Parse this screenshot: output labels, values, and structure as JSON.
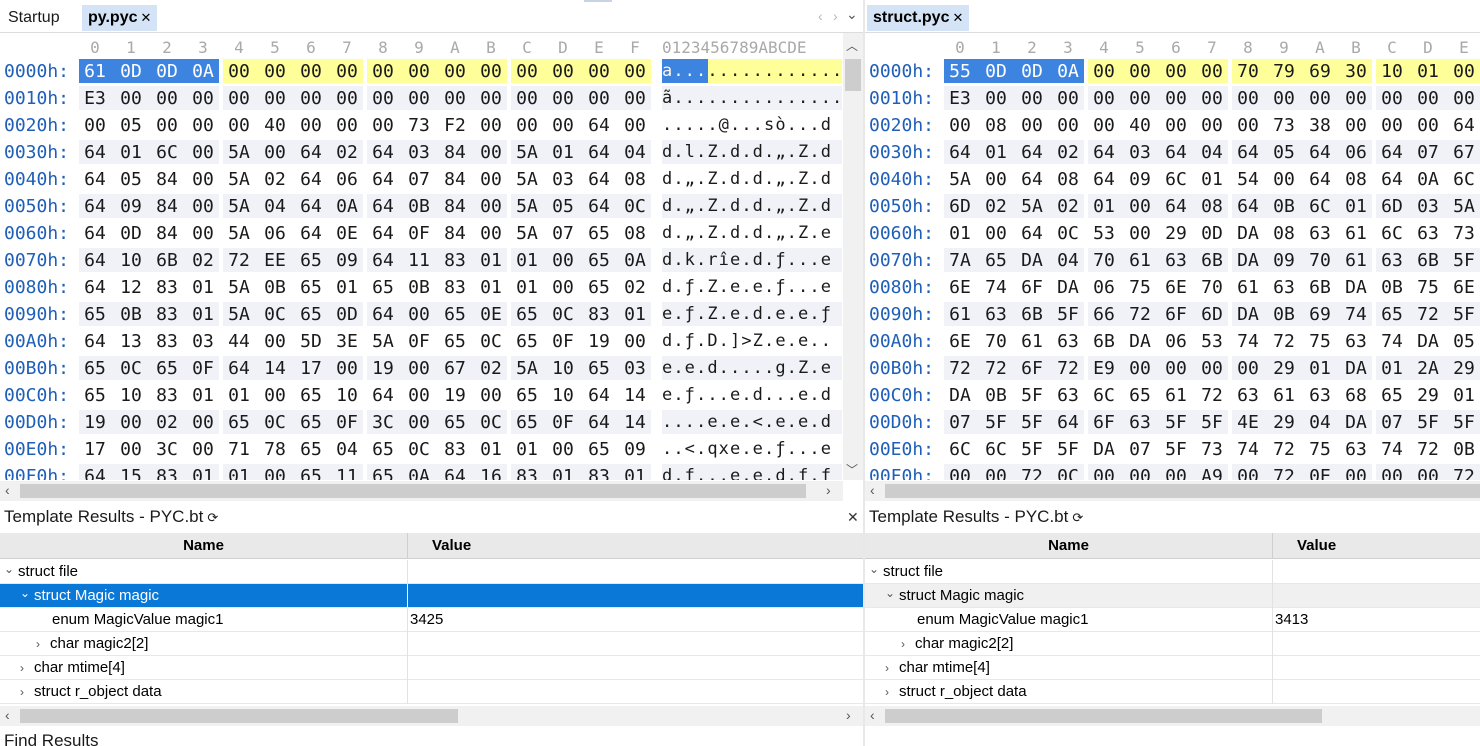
{
  "left": {
    "tabs": [
      {
        "label": "Startup",
        "active": false,
        "closable": false
      },
      {
        "label": "py.pyc",
        "active": true,
        "closable": true
      }
    ],
    "column_header": [
      "0",
      "1",
      "2",
      "3",
      "4",
      "5",
      "6",
      "7",
      "8",
      "9",
      "A",
      "B",
      "C",
      "D",
      "E",
      "F"
    ],
    "ascii_header": "0123456789ABCDE",
    "rows": [
      {
        "addr": "0000h:",
        "bytes": [
          "61",
          "0D",
          "0D",
          "0A",
          "00",
          "00",
          "00",
          "00",
          "00",
          "00",
          "00",
          "00",
          "00",
          "00",
          "00",
          "00"
        ],
        "ascii": "a..............."
      },
      {
        "addr": "0010h:",
        "bytes": [
          "E3",
          "00",
          "00",
          "00",
          "00",
          "00",
          "00",
          "00",
          "00",
          "00",
          "00",
          "00",
          "00",
          "00",
          "00",
          "00"
        ],
        "ascii": "ã..............."
      },
      {
        "addr": "0020h:",
        "bytes": [
          "00",
          "05",
          "00",
          "00",
          "00",
          "40",
          "00",
          "00",
          "00",
          "73",
          "F2",
          "00",
          "00",
          "00",
          "64",
          "00"
        ],
        "ascii": ".....@...sò...d"
      },
      {
        "addr": "0030h:",
        "bytes": [
          "64",
          "01",
          "6C",
          "00",
          "5A",
          "00",
          "64",
          "02",
          "64",
          "03",
          "84",
          "00",
          "5A",
          "01",
          "64",
          "04"
        ],
        "ascii": "d.l.Z.d.d.„.Z.d"
      },
      {
        "addr": "0040h:",
        "bytes": [
          "64",
          "05",
          "84",
          "00",
          "5A",
          "02",
          "64",
          "06",
          "64",
          "07",
          "84",
          "00",
          "5A",
          "03",
          "64",
          "08"
        ],
        "ascii": "d.„.Z.d.d.„.Z.d"
      },
      {
        "addr": "0050h:",
        "bytes": [
          "64",
          "09",
          "84",
          "00",
          "5A",
          "04",
          "64",
          "0A",
          "64",
          "0B",
          "84",
          "00",
          "5A",
          "05",
          "64",
          "0C"
        ],
        "ascii": "d.„.Z.d.d.„.Z.d"
      },
      {
        "addr": "0060h:",
        "bytes": [
          "64",
          "0D",
          "84",
          "00",
          "5A",
          "06",
          "64",
          "0E",
          "64",
          "0F",
          "84",
          "00",
          "5A",
          "07",
          "65",
          "08"
        ],
        "ascii": "d.„.Z.d.d.„.Z.e"
      },
      {
        "addr": "0070h:",
        "bytes": [
          "64",
          "10",
          "6B",
          "02",
          "72",
          "EE",
          "65",
          "09",
          "64",
          "11",
          "83",
          "01",
          "01",
          "00",
          "65",
          "0A"
        ],
        "ascii": "d.k.rîe.d.ƒ...e"
      },
      {
        "addr": "0080h:",
        "bytes": [
          "64",
          "12",
          "83",
          "01",
          "5A",
          "0B",
          "65",
          "01",
          "65",
          "0B",
          "83",
          "01",
          "01",
          "00",
          "65",
          "02"
        ],
        "ascii": "d.ƒ.Z.e.e.ƒ...e"
      },
      {
        "addr": "0090h:",
        "bytes": [
          "65",
          "0B",
          "83",
          "01",
          "5A",
          "0C",
          "65",
          "0D",
          "64",
          "00",
          "65",
          "0E",
          "65",
          "0C",
          "83",
          "01"
        ],
        "ascii": "e.ƒ.Z.e.d.e.e.ƒ"
      },
      {
        "addr": "00A0h:",
        "bytes": [
          "64",
          "13",
          "83",
          "03",
          "44",
          "00",
          "5D",
          "3E",
          "5A",
          "0F",
          "65",
          "0C",
          "65",
          "0F",
          "19",
          "00"
        ],
        "ascii": "d.ƒ.D.]>Z.e.e.."
      },
      {
        "addr": "00B0h:",
        "bytes": [
          "65",
          "0C",
          "65",
          "0F",
          "64",
          "14",
          "17",
          "00",
          "19",
          "00",
          "67",
          "02",
          "5A",
          "10",
          "65",
          "03"
        ],
        "ascii": "e.e.d.....g.Z.e"
      },
      {
        "addr": "00C0h:",
        "bytes": [
          "65",
          "10",
          "83",
          "01",
          "01",
          "00",
          "65",
          "10",
          "64",
          "00",
          "19",
          "00",
          "65",
          "10",
          "64",
          "14"
        ],
        "ascii": "e.ƒ...e.d...e.d"
      },
      {
        "addr": "00D0h:",
        "bytes": [
          "19",
          "00",
          "02",
          "00",
          "65",
          "0C",
          "65",
          "0F",
          "3C",
          "00",
          "65",
          "0C",
          "65",
          "0F",
          "64",
          "14"
        ],
        "ascii": "....e.e.<.e.e.d"
      },
      {
        "addr": "00E0h:",
        "bytes": [
          "17",
          "00",
          "3C",
          "00",
          "71",
          "78",
          "65",
          "04",
          "65",
          "0C",
          "83",
          "01",
          "01",
          "00",
          "65",
          "09"
        ],
        "ascii": "..<.qxe.e.ƒ...e"
      },
      {
        "addr": "00F0h:",
        "bytes": [
          "64",
          "15",
          "83",
          "01",
          "01",
          "00",
          "65",
          "11",
          "65",
          "0A",
          "64",
          "16",
          "83",
          "01",
          "83",
          "01"
        ],
        "ascii": "d.ƒ...e.e.d.ƒ.ƒ"
      }
    ],
    "template_title": "Template Results - PYC.bt",
    "grid": {
      "headers": [
        "Name",
        "Value"
      ],
      "rows": [
        {
          "name": "struct file",
          "value": "",
          "indent": 0,
          "chevron": "down"
        },
        {
          "name": "struct Magic magic",
          "value": "",
          "indent": 1,
          "chevron": "down",
          "selected": true
        },
        {
          "name": "enum MagicValue magic1",
          "value": "3425",
          "indent": 3,
          "chevron": ""
        },
        {
          "name": "char magic2[2]",
          "value": "",
          "indent": 2,
          "chevron": "right"
        },
        {
          "name": "char mtime[4]",
          "value": "",
          "indent": 1,
          "chevron": "right"
        },
        {
          "name": "struct r_object data",
          "value": "",
          "indent": 1,
          "chevron": "right"
        }
      ]
    }
  },
  "right": {
    "tabs": [
      {
        "label": "struct.pyc",
        "active": true,
        "closable": true
      }
    ],
    "column_header": [
      "0",
      "1",
      "2",
      "3",
      "4",
      "5",
      "6",
      "7",
      "8",
      "9",
      "A",
      "B",
      "C",
      "D",
      "E"
    ],
    "rows": [
      {
        "addr": "0000h:",
        "bytes": [
          "55",
          "0D",
          "0D",
          "0A",
          "00",
          "00",
          "00",
          "00",
          "70",
          "79",
          "69",
          "30",
          "10",
          "01",
          "00"
        ]
      },
      {
        "addr": "0010h:",
        "bytes": [
          "E3",
          "00",
          "00",
          "00",
          "00",
          "00",
          "00",
          "00",
          "00",
          "00",
          "00",
          "00",
          "00",
          "00",
          "00"
        ]
      },
      {
        "addr": "0020h:",
        "bytes": [
          "00",
          "08",
          "00",
          "00",
          "00",
          "40",
          "00",
          "00",
          "00",
          "73",
          "38",
          "00",
          "00",
          "00",
          "64"
        ]
      },
      {
        "addr": "0030h:",
        "bytes": [
          "64",
          "01",
          "64",
          "02",
          "64",
          "03",
          "64",
          "04",
          "64",
          "05",
          "64",
          "06",
          "64",
          "07",
          "67"
        ]
      },
      {
        "addr": "0040h:",
        "bytes": [
          "5A",
          "00",
          "64",
          "08",
          "64",
          "09",
          "6C",
          "01",
          "54",
          "00",
          "64",
          "08",
          "64",
          "0A",
          "6C"
        ]
      },
      {
        "addr": "0050h:",
        "bytes": [
          "6D",
          "02",
          "5A",
          "02",
          "01",
          "00",
          "64",
          "08",
          "64",
          "0B",
          "6C",
          "01",
          "6D",
          "03",
          "5A"
        ]
      },
      {
        "addr": "0060h:",
        "bytes": [
          "01",
          "00",
          "64",
          "0C",
          "53",
          "00",
          "29",
          "0D",
          "DA",
          "08",
          "63",
          "61",
          "6C",
          "63",
          "73"
        ]
      },
      {
        "addr": "0070h:",
        "bytes": [
          "7A",
          "65",
          "DA",
          "04",
          "70",
          "61",
          "63",
          "6B",
          "DA",
          "09",
          "70",
          "61",
          "63",
          "6B",
          "5F"
        ]
      },
      {
        "addr": "0080h:",
        "bytes": [
          "6E",
          "74",
          "6F",
          "DA",
          "06",
          "75",
          "6E",
          "70",
          "61",
          "63",
          "6B",
          "DA",
          "0B",
          "75",
          "6E"
        ]
      },
      {
        "addr": "0090h:",
        "bytes": [
          "61",
          "63",
          "6B",
          "5F",
          "66",
          "72",
          "6F",
          "6D",
          "DA",
          "0B",
          "69",
          "74",
          "65",
          "72",
          "5F"
        ]
      },
      {
        "addr": "00A0h:",
        "bytes": [
          "6E",
          "70",
          "61",
          "63",
          "6B",
          "DA",
          "06",
          "53",
          "74",
          "72",
          "75",
          "63",
          "74",
          "DA",
          "05"
        ]
      },
      {
        "addr": "00B0h:",
        "bytes": [
          "72",
          "72",
          "6F",
          "72",
          "E9",
          "00",
          "00",
          "00",
          "00",
          "29",
          "01",
          "DA",
          "01",
          "2A",
          "29"
        ]
      },
      {
        "addr": "00C0h:",
        "bytes": [
          "DA",
          "0B",
          "5F",
          "63",
          "6C",
          "65",
          "61",
          "72",
          "63",
          "61",
          "63",
          "68",
          "65",
          "29",
          "01"
        ]
      },
      {
        "addr": "00D0h:",
        "bytes": [
          "07",
          "5F",
          "5F",
          "64",
          "6F",
          "63",
          "5F",
          "5F",
          "4E",
          "29",
          "04",
          "DA",
          "07",
          "5F",
          "5F"
        ]
      },
      {
        "addr": "00E0h:",
        "bytes": [
          "6C",
          "6C",
          "5F",
          "5F",
          "DA",
          "07",
          "5F",
          "73",
          "74",
          "72",
          "75",
          "63",
          "74",
          "72",
          "0B"
        ]
      },
      {
        "addr": "00F0h:",
        "bytes": [
          "00",
          "00",
          "72",
          "0C",
          "00",
          "00",
          "00",
          "A9",
          "00",
          "72",
          "0E",
          "00",
          "00",
          "00",
          "72"
        ]
      }
    ],
    "template_title": "Template Results - PYC.bt",
    "grid": {
      "headers": [
        "Name",
        "Value"
      ],
      "rows": [
        {
          "name": "struct file",
          "value": "",
          "indent": 0,
          "chevron": "down"
        },
        {
          "name": "struct Magic magic",
          "value": "",
          "indent": 1,
          "chevron": "down",
          "alt": true
        },
        {
          "name": "enum MagicValue magic1",
          "value": "3413",
          "indent": 3,
          "chevron": ""
        },
        {
          "name": "char magic2[2]",
          "value": "",
          "indent": 2,
          "chevron": "right"
        },
        {
          "name": "char mtime[4]",
          "value": "",
          "indent": 1,
          "chevron": "right"
        },
        {
          "name": "struct r_object data",
          "value": "",
          "indent": 1,
          "chevron": "right"
        }
      ]
    }
  },
  "find_results_title": "Find Results",
  "icons": {
    "close": "close-icon",
    "refresh": "refresh-icon",
    "expand": "chevron-down-icon",
    "collapse": "chevron-right-icon"
  },
  "colors": {
    "address": "#1f5fb8",
    "highlight": "#ffff99",
    "selection": "#3d84e0",
    "grid_selected": "#0a78d7",
    "active_tab": "#d4e3f5"
  }
}
